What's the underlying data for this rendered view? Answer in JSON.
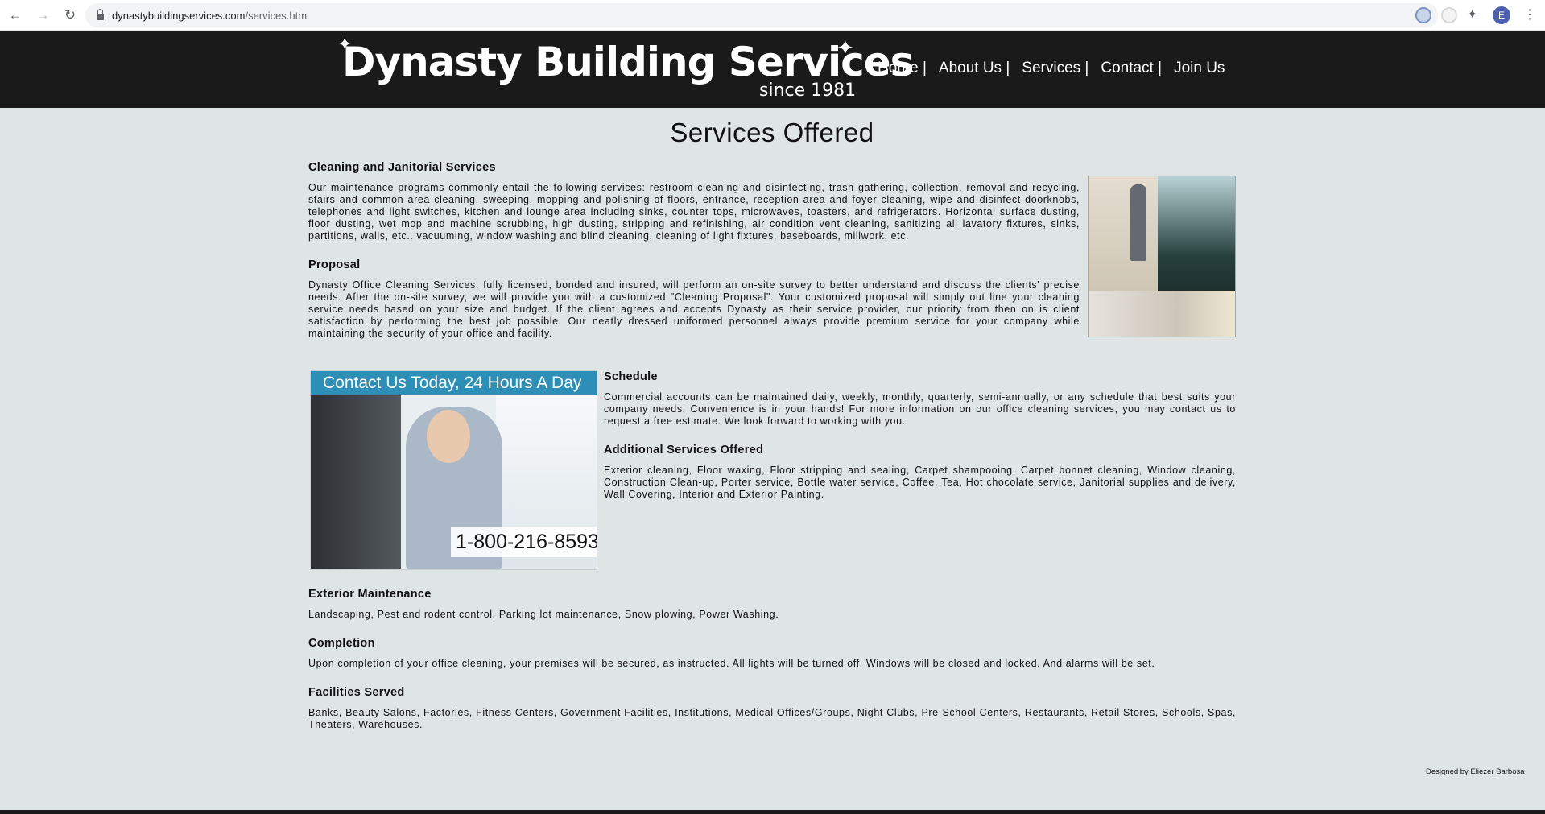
{
  "browser": {
    "url_domain": "dynastybuildingservices.com",
    "url_path": "/services.htm",
    "profile_initial": "E"
  },
  "header": {
    "logo_title": "Dynasty Building Services",
    "logo_sub": "since 1981",
    "nav": [
      "Home |",
      "About Us |",
      "Services |",
      "Contact |",
      "Join Us"
    ]
  },
  "page": {
    "title": "Services Offered",
    "sections": {
      "cleaning": {
        "heading": "Cleaning and Janitorial Services",
        "text": "Our maintenance programs commonly entail the following services: restroom cleaning and disinfecting, trash gathering, collection, removal and recycling, stairs and common area cleaning, sweeping, mopping and polishing of floors, entrance, reception area and foyer cleaning, wipe and disinfect doorknobs, telephones and light switches, kitchen and lounge area including sinks, counter tops, microwaves, toasters, and refrigerators. Horizontal surface dusting, floor dusting, wet mop and machine scrubbing, high dusting, stripping and refinishing, air condition vent cleaning, sanitizing all lavatory fixtures, sinks, partitions, walls, etc.. vacuuming, window washing and blind cleaning, cleaning of light fixtures, baseboards, millwork, etc."
      },
      "proposal": {
        "heading": "Proposal",
        "text": "Dynasty Office Cleaning Services, fully licensed, bonded and insured, will perform an on-site survey to better understand and discuss the clients' precise needs. After the on-site survey, we will provide you with a customized \"Cleaning Proposal\". Your customized proposal will simply out line your cleaning service needs based on your size and budget. If the client agrees and accepts Dynasty as their service provider, our priority from then on is client satisfaction by performing the best job possible. Our neatly dressed uniformed personnel always provide premium service for your company while maintaining the security of your office and facility."
      },
      "schedule": {
        "heading": "Schedule",
        "text": "Commercial accounts can be maintained daily, weekly, monthly, quarterly, semi-annually, or any schedule that best suits your company needs. Convenience is in your hands! For more information on our office cleaning services, you may contact us to request a free estimate. We look forward to working with you."
      },
      "additional": {
        "heading": "Additional Services Offered",
        "text": "Exterior cleaning, Floor waxing, Floor stripping and sealing, Carpet shampooing, Carpet bonnet cleaning, Window cleaning, Construction Clean-up, Porter service, Bottle water service, Coffee, Tea, Hot chocolate service, Janitorial supplies and delivery, Wall Covering, Interior and Exterior Painting."
      },
      "exterior": {
        "heading": "Exterior Maintenance",
        "text": "Landscaping, Pest and rodent control, Parking lot maintenance, Snow plowing, Power Washing."
      },
      "completion": {
        "heading": "Completion",
        "text": "Upon completion of your office cleaning, your premises will be secured, as instructed. All lights will be turned off. Windows will be closed and locked. And alarms will be set."
      },
      "facilities": {
        "heading": "Facilities Served",
        "text": "Banks, Beauty Salons, Factories, Fitness Centers, Government Facilities, Institutions, Medical Offices/Groups, Night Clubs, Pre-School Centers, Restaurants, Retail Stores, Schools, Spas, Theaters, Warehouses."
      }
    },
    "contact_ad": {
      "banner": "Contact Us Today, 24 Hours A Day",
      "phone": "1-800-216-8593"
    },
    "footer_credit": "Designed by Eliezer Barbosa"
  }
}
